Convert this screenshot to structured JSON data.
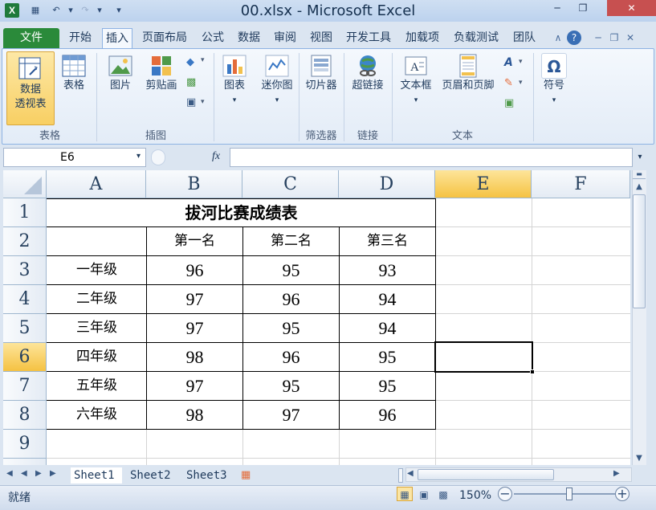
{
  "window": {
    "title": "00.xlsx - Microsoft Excel",
    "app_icon": "X"
  },
  "menu_tabs": [
    "文件",
    "开始",
    "插入",
    "页面布局",
    "公式",
    "数据",
    "审阅",
    "视图",
    "开发工具",
    "加载项",
    "负载测试",
    "团队"
  ],
  "active_tab": "插入",
  "ribbon": {
    "pivot_label_1": "数据",
    "pivot_label_2": "透视表",
    "table": "表格",
    "picture": "图片",
    "clipart": "剪贴画",
    "chart": "图表",
    "sparkline": "迷你图",
    "slicer": "切片器",
    "hyperlink": "超链接",
    "textbox": "文本框",
    "header_footer": "页眉和页脚",
    "symbol": "符号",
    "groups": {
      "tables": "表格",
      "illustrations": "插图",
      "filter": "筛选器",
      "links": "链接",
      "text": "文本"
    }
  },
  "formula_bar": {
    "name_box": "E6",
    "fx": "fx",
    "formula": ""
  },
  "columns": [
    "A",
    "B",
    "C",
    "D",
    "E",
    "F"
  ],
  "rows": [
    "1",
    "2",
    "3",
    "4",
    "5",
    "6",
    "7",
    "8",
    "9"
  ],
  "selected_cell": "E6",
  "sheet": {
    "title": "拔河比赛成绩表",
    "headers": [
      "第一名",
      "第二名",
      "第三名"
    ],
    "data": [
      {
        "grade": "一年级",
        "v": [
          "96",
          "95",
          "93"
        ]
      },
      {
        "grade": "二年级",
        "v": [
          "97",
          "96",
          "94"
        ]
      },
      {
        "grade": "三年级",
        "v": [
          "97",
          "95",
          "94"
        ]
      },
      {
        "grade": "四年级",
        "v": [
          "98",
          "96",
          "95"
        ]
      },
      {
        "grade": "五年级",
        "v": [
          "97",
          "95",
          "95"
        ]
      },
      {
        "grade": "六年级",
        "v": [
          "98",
          "97",
          "96"
        ]
      }
    ]
  },
  "sheet_tabs": [
    "Sheet1",
    "Sheet2",
    "Sheet3"
  ],
  "status": {
    "text": "就绪",
    "zoom": "150%"
  },
  "colors": {
    "accent_green": "#2a8a3a",
    "selected_header": "#f5c242",
    "close_red": "#c75050"
  }
}
